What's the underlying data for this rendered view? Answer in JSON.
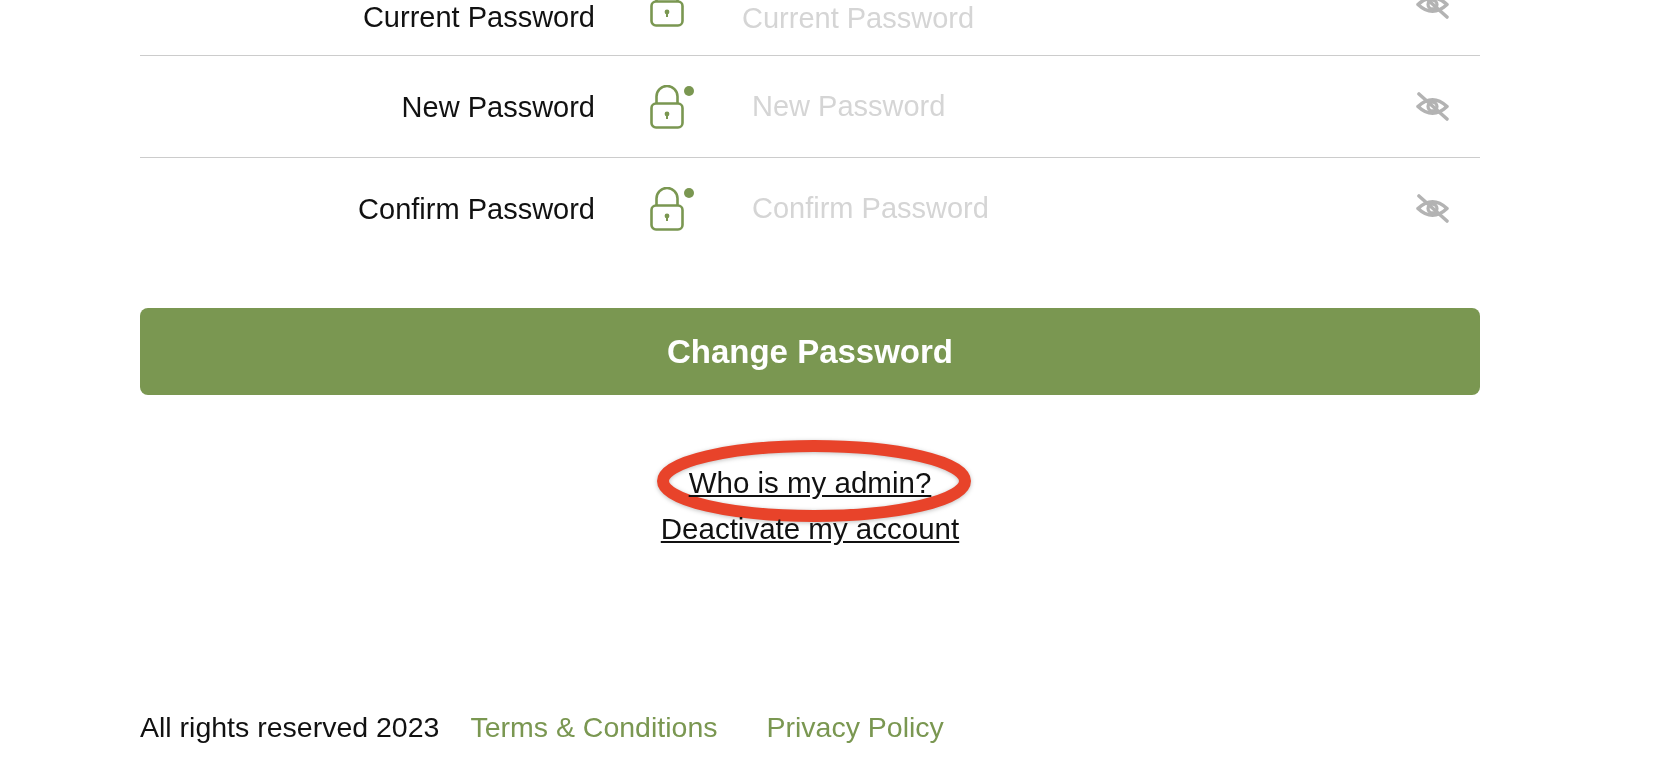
{
  "password_fields": [
    {
      "label": "Current Password",
      "placeholder": "Current Password",
      "indicator_dot": false
    },
    {
      "label": "New Password",
      "placeholder": "New Password",
      "indicator_dot": true
    },
    {
      "label": "Confirm Password",
      "placeholder": "Confirm Password",
      "indicator_dot": true
    }
  ],
  "submit_button": {
    "label": "Change Password"
  },
  "links": [
    {
      "text": "Who is my admin?",
      "circled": true
    },
    {
      "text": "Deactivate my account",
      "circled": false
    }
  ],
  "footer": {
    "copyright": "All rights reserved 2023",
    "links": [
      "Terms & Conditions",
      "Privacy Policy"
    ]
  }
}
